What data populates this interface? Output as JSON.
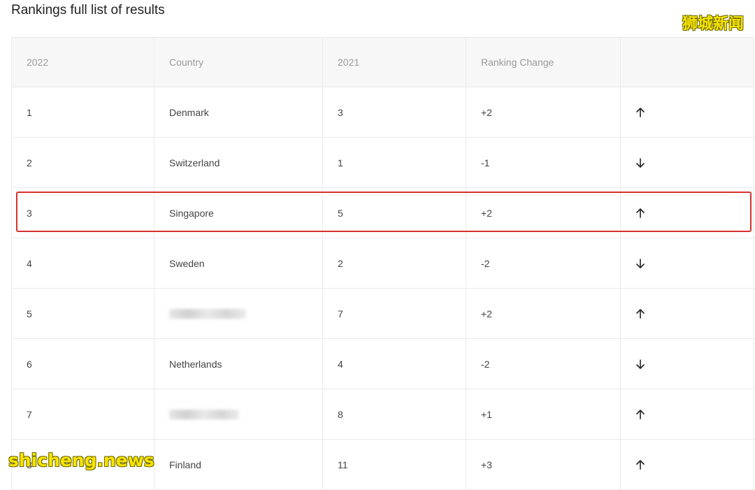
{
  "title": "Rankings full list of results",
  "watermark_top": "狮城新闻",
  "watermark_bottom": "shicheng.news",
  "columns": [
    "2022",
    "Country",
    "2021",
    "Ranking Change",
    ""
  ],
  "rows": [
    {
      "rank_2022": "1",
      "country": "Denmark",
      "rank_2021": "3",
      "change": "+2",
      "direction": "up",
      "redacted": false
    },
    {
      "rank_2022": "2",
      "country": "Switzerland",
      "rank_2021": "1",
      "change": "-1",
      "direction": "down",
      "redacted": false
    },
    {
      "rank_2022": "3",
      "country": "Singapore",
      "rank_2021": "5",
      "change": "+2",
      "direction": "up",
      "redacted": false,
      "highlighted": true
    },
    {
      "rank_2022": "4",
      "country": "Sweden",
      "rank_2021": "2",
      "change": "-2",
      "direction": "down",
      "redacted": false
    },
    {
      "rank_2022": "5",
      "country": "",
      "rank_2021": "7",
      "change": "+2",
      "direction": "up",
      "redacted": true
    },
    {
      "rank_2022": "6",
      "country": "Netherlands",
      "rank_2021": "4",
      "change": "-2",
      "direction": "down",
      "redacted": false
    },
    {
      "rank_2022": "7",
      "country": "",
      "rank_2021": "8",
      "change": "+1",
      "direction": "up",
      "redacted": true
    },
    {
      "rank_2022": "8",
      "country": "Finland",
      "rank_2021": "11",
      "change": "+3",
      "direction": "up",
      "redacted": false
    }
  ],
  "colors": {
    "highlight": "#d9312b",
    "watermark": "#f7e400"
  },
  "icons": {
    "up": "arrow-up-icon",
    "down": "arrow-down-icon"
  }
}
